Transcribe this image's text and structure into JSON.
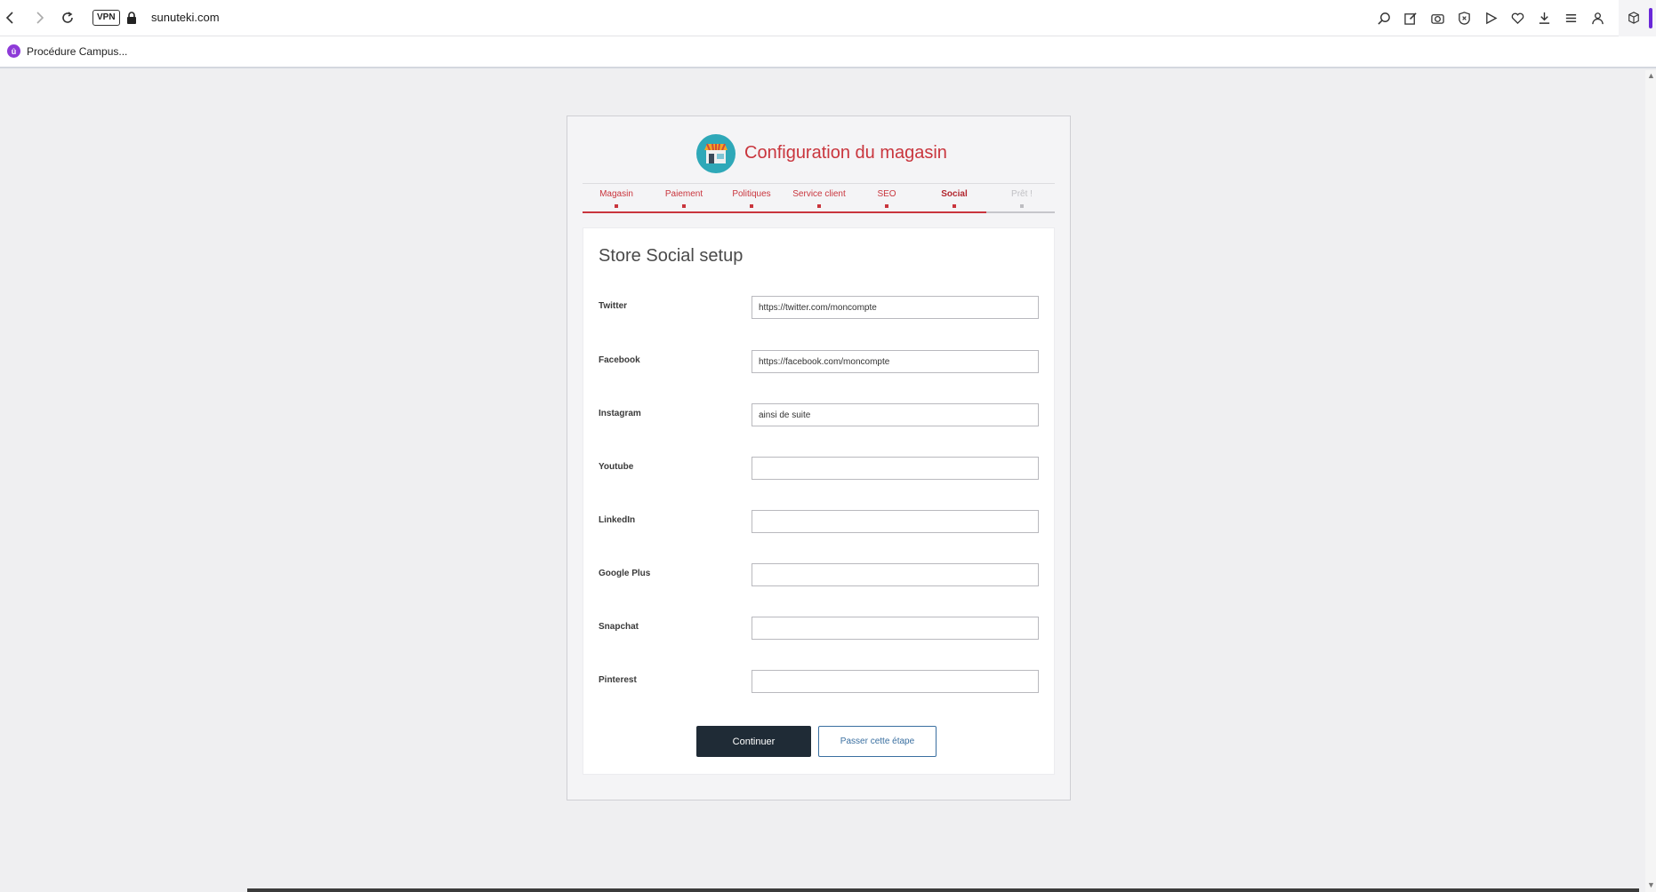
{
  "browser": {
    "vpn_label": "VPN",
    "url": "sunuteki.com",
    "bookmark": {
      "label": "Procédure Campus...",
      "icon_letter": "û"
    }
  },
  "header": {
    "title": "Configuration du magasin",
    "logo_icon": "store-icon"
  },
  "steps": [
    {
      "label": "Magasin",
      "state": "done"
    },
    {
      "label": "Paiement",
      "state": "done"
    },
    {
      "label": "Politiques",
      "state": "done"
    },
    {
      "label": "Service client",
      "state": "done"
    },
    {
      "label": "SEO",
      "state": "done"
    },
    {
      "label": "Social",
      "state": "active"
    },
    {
      "label": "Prêt !",
      "state": "todo"
    }
  ],
  "form": {
    "title": "Store Social setup",
    "fields": [
      {
        "label": "Twitter",
        "value": "https://twitter.com/moncompte"
      },
      {
        "label": "Facebook",
        "value": "https://facebook.com/moncompte"
      },
      {
        "label": "Instagram",
        "value": "ainsi de suite"
      },
      {
        "label": "Youtube",
        "value": ""
      },
      {
        "label": "LinkedIn",
        "value": ""
      },
      {
        "label": "Google Plus",
        "value": ""
      },
      {
        "label": "Snapchat",
        "value": ""
      },
      {
        "label": "Pinterest",
        "value": ""
      }
    ],
    "continue_label": "Continuer",
    "skip_label": "Passer cette étape"
  },
  "colors": {
    "accent": "#c9353d",
    "primary_button": "#1f2b36",
    "skip_border": "#3a6fa0",
    "logo_bg": "#2ea8b8"
  }
}
